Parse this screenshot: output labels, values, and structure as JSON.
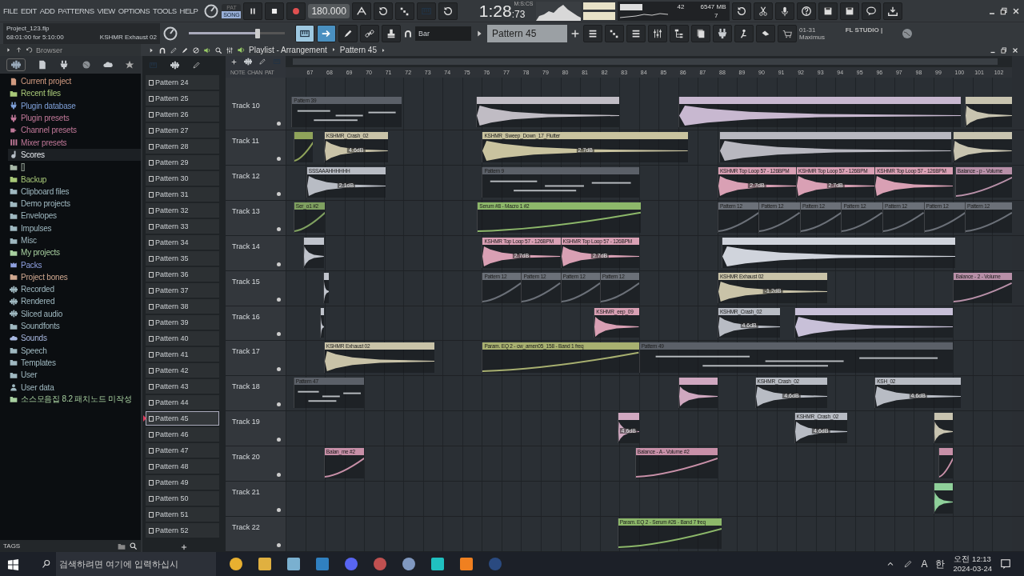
{
  "menu": [
    "FILE",
    "EDIT",
    "ADD",
    "PATTERNS",
    "VIEW",
    "OPTIONS",
    "TOOLS",
    "HELP"
  ],
  "transport": {
    "modes": [
      {
        "label": "PAT",
        "selected": false
      },
      {
        "label": "SONG",
        "selected": true
      }
    ],
    "tempo": "180.000"
  },
  "clock": {
    "time": "1:28",
    "centis": ":73",
    "unit": "M:S:CS"
  },
  "monitor": {
    "cpu": "42",
    "memory": "6547 MB",
    "polyphony": "7"
  },
  "hint": {
    "code": "01-31",
    "title": "FL STUDIO |",
    "text": "Maximus"
  },
  "project": {
    "file": "Project_123.flp",
    "time": "68:01:00 for 5:10:00",
    "channel": "KSHMR Exhaust 02"
  },
  "master": {
    "level": 0.72
  },
  "snap": "Bar",
  "pattern": "Pattern 45",
  "browser": {
    "title": "Browser",
    "tags": "TAGS",
    "items": [
      {
        "label": "Current project",
        "kind": "document",
        "color": "#d09a80",
        "selected": false
      },
      {
        "label": "Recent files",
        "kind": "folder",
        "color": "#a8c878",
        "selected": false
      },
      {
        "label": "Plugin database",
        "kind": "plug",
        "color": "#7fa0d8",
        "selected": false
      },
      {
        "label": "Plugin presets",
        "kind": "plug",
        "color": "#c07898",
        "selected": false
      },
      {
        "label": "Channel presets",
        "kind": "channel",
        "color": "#c07898",
        "selected": false
      },
      {
        "label": "Mixer presets",
        "kind": "mixer",
        "color": "#c07898",
        "selected": false
      },
      {
        "label": "Scores",
        "kind": "note",
        "color": "#b8c0c8",
        "selected": true
      },
      {
        "label": "[]",
        "kind": "folder",
        "color": "#a8b8a8",
        "selected": false
      },
      {
        "label": "Backup",
        "kind": "folder",
        "color": "#a8c878",
        "selected": false
      },
      {
        "label": "Clipboard files",
        "kind": "folder",
        "color": "#9fb8c0",
        "selected": false
      },
      {
        "label": "Demo projects",
        "kind": "folder",
        "color": "#9fb8c0",
        "selected": false
      },
      {
        "label": "Envelopes",
        "kind": "folder",
        "color": "#9fb8c0",
        "selected": false
      },
      {
        "label": "Impulses",
        "kind": "folder",
        "color": "#9fb8c0",
        "selected": false
      },
      {
        "label": "Misc",
        "kind": "folder",
        "color": "#9fb8c0",
        "selected": false
      },
      {
        "label": "My projects",
        "kind": "folder",
        "color": "#a8d0a0",
        "selected": false
      },
      {
        "label": "Packs",
        "kind": "packs",
        "color": "#8fa0e0",
        "selected": false
      },
      {
        "label": "Project bones",
        "kind": "folder",
        "color": "#d0a890",
        "selected": false
      },
      {
        "label": "Recorded",
        "kind": "wave",
        "color": "#9fb8c0",
        "selected": false
      },
      {
        "label": "Rendered",
        "kind": "wave",
        "color": "#9fb8c0",
        "selected": false
      },
      {
        "label": "Sliced audio",
        "kind": "wave",
        "color": "#9fb8c0",
        "selected": false
      },
      {
        "label": "Soundfonts",
        "kind": "folder",
        "color": "#9fb8c0",
        "selected": false
      },
      {
        "label": "Sounds",
        "kind": "cloud",
        "color": "#a8b8e0",
        "selected": false
      },
      {
        "label": "Speech",
        "kind": "folder",
        "color": "#9fb8c0",
        "selected": false
      },
      {
        "label": "Templates",
        "kind": "folder",
        "color": "#9fb8c0",
        "selected": false
      },
      {
        "label": "User",
        "kind": "folder",
        "color": "#9fb8c0",
        "selected": false
      },
      {
        "label": "User data",
        "kind": "user",
        "color": "#9fb8c0",
        "selected": false
      },
      {
        "label": "소스모음집 8.2 패치노드 미작성",
        "kind": "folder",
        "color": "#a8d0a0",
        "selected": false
      }
    ]
  },
  "patterns": [
    {
      "label": "Pattern 24",
      "selected": false
    },
    {
      "label": "Pattern 25",
      "selected": false
    },
    {
      "label": "Pattern 26",
      "selected": false
    },
    {
      "label": "Pattern 27",
      "selected": false
    },
    {
      "label": "Pattern 28",
      "selected": false
    },
    {
      "label": "Pattern 29",
      "selected": false
    },
    {
      "label": "Pattern 30",
      "selected": false
    },
    {
      "label": "Pattern 31",
      "selected": false
    },
    {
      "label": "Pattern 32",
      "selected": false
    },
    {
      "label": "Pattern 33",
      "selected": false
    },
    {
      "label": "Pattern 34",
      "selected": false
    },
    {
      "label": "Pattern 35",
      "selected": false
    },
    {
      "label": "Pattern 36",
      "selected": false
    },
    {
      "label": "Pattern 37",
      "selected": false
    },
    {
      "label": "Pattern 38",
      "selected": false
    },
    {
      "label": "Pattern 39",
      "selected": false
    },
    {
      "label": "Pattern 40",
      "selected": false
    },
    {
      "label": "Pattern 41",
      "selected": false
    },
    {
      "label": "Pattern 42",
      "selected": false
    },
    {
      "label": "Pattern 43",
      "selected": false
    },
    {
      "label": "Pattern 44",
      "selected": false
    },
    {
      "label": "Pattern 45",
      "selected": true
    },
    {
      "label": "Pattern 46",
      "selected": false
    },
    {
      "label": "Pattern 47",
      "selected": false
    },
    {
      "label": "Pattern 48",
      "selected": false
    },
    {
      "label": "Pattern 49",
      "selected": false
    },
    {
      "label": "Pattern 50",
      "selected": false
    },
    {
      "label": "Pattern 51",
      "selected": false
    },
    {
      "label": "Pattern 52",
      "selected": false
    }
  ],
  "playlist": {
    "title": "Playlist - Arrangement",
    "pattern": "Pattern 45",
    "header_labels": [
      "NOTE",
      "CHAN",
      "PAT"
    ],
    "ruler": [
      "67",
      "68",
      "69",
      "70",
      "71",
      "72",
      "73",
      "74",
      "75",
      "76",
      "77",
      "78",
      "79",
      "80",
      "81",
      "82",
      "83",
      "84",
      "85",
      "86",
      "87",
      "88",
      "89",
      "90",
      "91",
      "92",
      "93",
      "94",
      "95",
      "96",
      "97",
      "98",
      "99",
      "100",
      "101",
      "102"
    ],
    "tracks": [
      {
        "name": "Track 10",
        "clips": [
          {
            "kind": "pattern",
            "label": "Pattern 39",
            "color": "#5b6068"
          },
          {
            "kind": "audio",
            "color": "#c0bcc4"
          },
          {
            "kind": "audio",
            "color": "#c8b8d0"
          },
          {
            "kind": "audio",
            "color": "#c8c4b0"
          }
        ]
      },
      {
        "name": "Track 11",
        "clips": [
          {
            "kind": "automation",
            "color": "#8fa35a"
          },
          {
            "kind": "audio",
            "label": "KSHMR_Crash_02",
            "reading": "4.6dB",
            "color": "#c9c3a8"
          },
          {
            "kind": "audio",
            "label": "KSHMR_Sweep_Down_17_Flutter",
            "reading": "2.7dB",
            "color": "#c9c39f"
          },
          {
            "kind": "audio",
            "color": "#b8b8c0"
          },
          {
            "kind": "audio",
            "color": "#c8c4b0"
          }
        ]
      },
      {
        "name": "Track 12",
        "clips": [
          {
            "kind": "audio",
            "label": "SSSAAAHHHHHH",
            "reading": "2.1dB",
            "color": "#b8bcc4"
          },
          {
            "kind": "pattern",
            "label": "Pattern 9",
            "color": "#5b6068"
          },
          {
            "kind": "audio",
            "label": "KSHMR Top Loop 57 - 126BPM",
            "reading": "2.7dB",
            "color": "#d9a0b4"
          },
          {
            "kind": "audio",
            "label": "KSHMR Top Loop 57 - 126BPM",
            "reading": "2.7dB",
            "color": "#d9a0b4"
          },
          {
            "kind": "audio",
            "label": "KSHMR Top Loop 57 - 126BPM",
            "color": "#d9a0b4"
          },
          {
            "kind": "automation",
            "label": "Balance - p - Volume",
            "color": "#b890a8"
          }
        ]
      },
      {
        "name": "Track 13",
        "clips": [
          {
            "kind": "automation",
            "label": "Ser_o1 #2",
            "color": "#7fa060"
          },
          {
            "kind": "automation",
            "label": "Serum #8 - Macro 1 #2",
            "color": "#8db86a"
          },
          {
            "kind": "automation",
            "label": "Pattern 12",
            "color": "#6b7078"
          },
          {
            "kind": "automation",
            "label": "Pattern 12",
            "color": "#6b7078"
          },
          {
            "kind": "automation",
            "label": "Pattern 12",
            "color": "#6b7078"
          },
          {
            "kind": "automation",
            "label": "Pattern 12",
            "color": "#6b7078"
          },
          {
            "kind": "automation",
            "label": "Pattern 12",
            "color": "#6b7078"
          },
          {
            "kind": "automation",
            "label": "Pattern 12",
            "color": "#6b7078"
          },
          {
            "kind": "automation",
            "label": "Pattern 12",
            "color": "#6b7078"
          }
        ]
      },
      {
        "name": "Track 14",
        "clips": [
          {
            "kind": "audio",
            "color": "#c0c4cc"
          },
          {
            "kind": "audio",
            "label": "KSHMR Top Loop 57 - 126BPM",
            "reading": "2.7dB",
            "color": "#d9a0b4"
          },
          {
            "kind": "audio",
            "label": "KSHMR Top Loop 57 - 126BPM",
            "reading": "2.7dB",
            "color": "#d9a0b4"
          },
          {
            "kind": "audio",
            "color": "#d0d4dc"
          }
        ]
      },
      {
        "name": "Track 15",
        "clips": [
          {
            "kind": "audio",
            "color": "#c0c4cc"
          },
          {
            "kind": "automation",
            "label": "Pattern 12",
            "color": "#6b7078"
          },
          {
            "kind": "automation",
            "label": "Pattern 12",
            "color": "#6b7078"
          },
          {
            "kind": "automation",
            "label": "Pattern 12",
            "color": "#6b7078"
          },
          {
            "kind": "automation",
            "label": "Pattern 12",
            "color": "#6b7078"
          },
          {
            "kind": "audio",
            "label": "KSHMR Exhaust 02",
            "reading": "-1.2dB",
            "color": "#c9c3a8"
          },
          {
            "kind": "automation",
            "label": "Balance - 2 - Volume",
            "color": "#b890a8"
          }
        ]
      },
      {
        "name": "Track 16",
        "clips": [
          {
            "kind": "audio",
            "color": "#c0c4cc"
          },
          {
            "kind": "audio",
            "label": "KSHMR_eep_09",
            "color": "#d9a0b4"
          },
          {
            "kind": "audio",
            "label": "KSHMR_Crash_02",
            "reading": "4.6dB",
            "color": "#b8bcc4"
          },
          {
            "kind": "audio",
            "color": "#c8c0d8"
          }
        ]
      },
      {
        "name": "Track 17",
        "clips": [
          {
            "kind": "audio",
            "label": "KSHMR Exhaust 02",
            "color": "#c9c3a8"
          },
          {
            "kind": "automation",
            "label": "Param. EQ 2 - cw_amen05_158 - Band 1 freq",
            "color": "#a8b070"
          },
          {
            "kind": "pattern",
            "label": "Pattern 49",
            "color": "#5b6068"
          }
        ]
      },
      {
        "name": "Track 18",
        "clips": [
          {
            "kind": "pattern",
            "label": "Pattern 47",
            "color": "#5b6068"
          },
          {
            "kind": "audio",
            "color": "#d0a8c0"
          },
          {
            "kind": "audio",
            "label": "KSHMR_Crash_02",
            "reading": "4.6dB",
            "color": "#b8bcc4"
          },
          {
            "kind": "audio",
            "label": "KSH_02",
            "reading": "4.6dB",
            "color": "#b8bcc4"
          }
        ]
      },
      {
        "name": "Track 19",
        "clips": [
          {
            "kind": "audio",
            "reading": "4.6dB",
            "color": "#d0a8c0"
          },
          {
            "kind": "audio",
            "label": "KSHMR_Crash_02",
            "reading": "4.6dB",
            "color": "#b8bcc4"
          },
          {
            "kind": "audio",
            "color": "#c8c4b0"
          }
        ]
      },
      {
        "name": "Track 20",
        "clips": [
          {
            "kind": "automation",
            "label": "Balan_me #2",
            "color": "#c890a8"
          },
          {
            "kind": "automation",
            "label": "Balance - A - Volume #2",
            "color": "#c890a8"
          },
          {
            "kind": "automation",
            "color": "#c890a8"
          }
        ]
      },
      {
        "name": "Track 21",
        "clips": [
          {
            "kind": "audio",
            "color": "#8fd09a"
          }
        ]
      },
      {
        "name": "Track 22",
        "clips": [
          {
            "kind": "automation",
            "label": "Param. EQ 2 - Serum #26 - Band 7 freq",
            "color": "#8db86a"
          }
        ]
      }
    ]
  },
  "taskbar": {
    "search_placeholder": "검색하려면 여기에 입력하십시",
    "ime": [
      "A",
      "한"
    ],
    "time": "오전 12:13",
    "date": "2024-03-24"
  }
}
